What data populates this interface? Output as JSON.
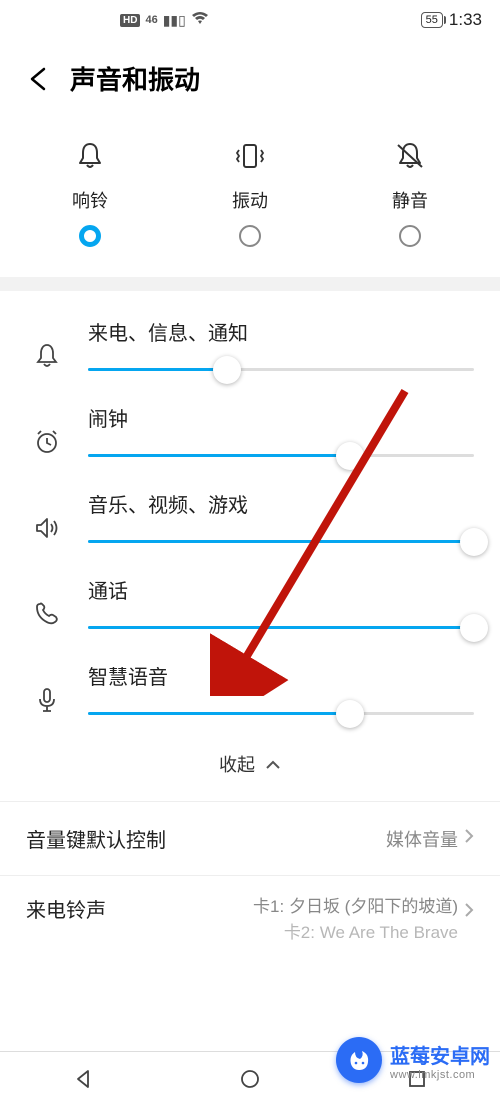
{
  "status": {
    "hd": "HD",
    "net": "46",
    "battery": "55",
    "time": "1:33"
  },
  "header": {
    "title": "声音和振动"
  },
  "modes": [
    {
      "label": "响铃",
      "selected": true,
      "icon": "bell"
    },
    {
      "label": "振动",
      "selected": false,
      "icon": "vibrate"
    },
    {
      "label": "静音",
      "selected": false,
      "icon": "mute"
    }
  ],
  "sliders": [
    {
      "label": "来电、信息、通知",
      "icon": "bell",
      "value": 36
    },
    {
      "label": "闹钟",
      "icon": "clock",
      "value": 68
    },
    {
      "label": "音乐、视频、游戏",
      "icon": "speaker",
      "value": 100
    },
    {
      "label": "通话",
      "icon": "phone",
      "value": 100
    },
    {
      "label": "智慧语音",
      "icon": "mic",
      "value": 68
    }
  ],
  "collapse": "收起",
  "volume_key": {
    "label": "音量键默认控制",
    "value": "媒体音量"
  },
  "ringtone": {
    "label": "来电铃声",
    "card1": "卡1: 夕日坂 (夕阳下的坡道)",
    "card2": "卡2: We Are The Brave"
  },
  "watermark": {
    "cn": "蓝莓安卓网",
    "url": "www.lmkjst.com"
  }
}
